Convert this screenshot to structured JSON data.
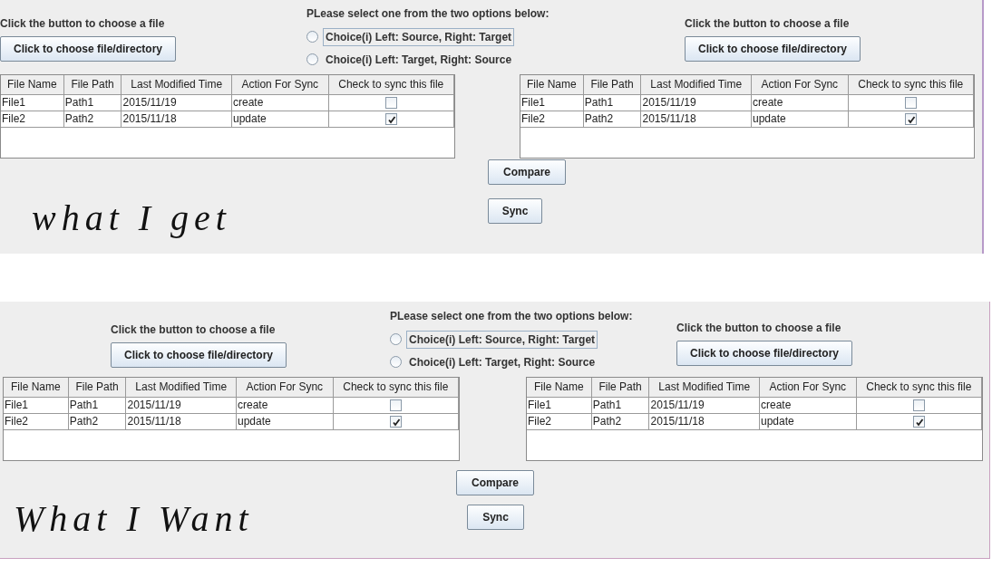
{
  "panels": [
    {
      "left_chooser": {
        "label": "Click the button to choose a file",
        "button": "Click to choose file/directory"
      },
      "options": {
        "prompt": "PLease select one from the two options below:",
        "choices": [
          {
            "label": "Choice(i) Left: Source, Right: Target",
            "selected": false,
            "focused": true
          },
          {
            "label": "Choice(i) Left: Target, Right: Source",
            "selected": false,
            "focused": false
          }
        ]
      },
      "right_chooser": {
        "label": "Click the button to choose a file",
        "button": "Click to choose file/directory"
      },
      "tables": [
        {
          "columns": [
            "File Name",
            "File Path",
            "Last Modified Time",
            "Action For Sync",
            "Check to sync this file"
          ],
          "rows": [
            {
              "cells": [
                "File1",
                "Path1",
                "2015/11/19",
                "create"
              ],
              "checked": false
            },
            {
              "cells": [
                "File2",
                "Path2",
                "2015/11/18",
                "update"
              ],
              "checked": true
            }
          ]
        },
        {
          "columns": [
            "File Name",
            "File Path",
            "Last Modified Time",
            "Action For Sync",
            "Check to sync this file"
          ],
          "rows": [
            {
              "cells": [
                "File1",
                "Path1",
                "2015/11/19",
                "create"
              ],
              "checked": false
            },
            {
              "cells": [
                "File2",
                "Path2",
                "2015/11/18",
                "update"
              ],
              "checked": true
            }
          ]
        }
      ],
      "buttons": [
        "Compare",
        "Sync"
      ],
      "caption": "what I get"
    },
    {
      "left_chooser": {
        "label": "Click the button to choose a file",
        "button": "Click to choose file/directory"
      },
      "options": {
        "prompt": "PLease select one from the two options below:",
        "choices": [
          {
            "label": "Choice(i) Left: Source, Right: Target",
            "selected": false,
            "focused": true
          },
          {
            "label": "Choice(i) Left: Target, Right: Source",
            "selected": false,
            "focused": false
          }
        ]
      },
      "right_chooser": {
        "label": "Click the button to choose a file",
        "button": "Click to choose file/directory"
      },
      "tables": [
        {
          "columns": [
            "File Name",
            "File Path",
            "Last Modified Time",
            "Action For Sync",
            "Check to sync this file"
          ],
          "rows": [
            {
              "cells": [
                "File1",
                "Path1",
                "2015/11/19",
                "create"
              ],
              "checked": false
            },
            {
              "cells": [
                "File2",
                "Path2",
                "2015/11/18",
                "update"
              ],
              "checked": true
            }
          ]
        },
        {
          "columns": [
            "File Name",
            "File Path",
            "Last Modified Time",
            "Action For Sync",
            "Check to sync this file"
          ],
          "rows": [
            {
              "cells": [
                "File1",
                "Path1",
                "2015/11/19",
                "create"
              ],
              "checked": false
            },
            {
              "cells": [
                "File2",
                "Path2",
                "2015/11/18",
                "update"
              ],
              "checked": true
            }
          ]
        }
      ],
      "buttons": [
        "Compare",
        "Sync"
      ],
      "caption": "What I Want"
    }
  ]
}
